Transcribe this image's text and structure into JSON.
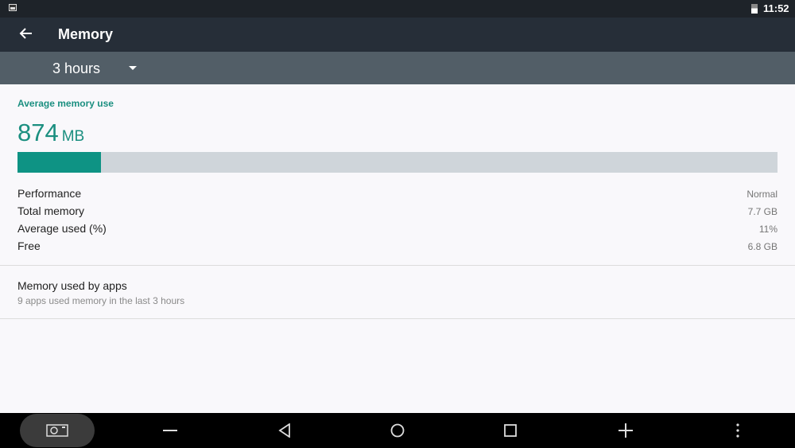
{
  "status_bar": {
    "time": "11:52",
    "icons": [
      "image-notification-icon",
      "battery-icon"
    ]
  },
  "app_bar": {
    "back_icon": "arrow-left-icon",
    "title": "Memory"
  },
  "filter": {
    "selected": "3 hours",
    "icon": "dropdown-caret-icon"
  },
  "summary": {
    "label": "Average memory use",
    "value": "874",
    "unit": "MB",
    "usage_fraction": 0.11,
    "accent_color": "#0e9384",
    "track_color": "#cfd5da"
  },
  "stats": [
    {
      "label": "Performance",
      "value": "Normal"
    },
    {
      "label": "Total memory",
      "value": "7.7 GB"
    },
    {
      "label": "Average used (%)",
      "value": "11%"
    },
    {
      "label": "Free",
      "value": "6.8 GB"
    }
  ],
  "apps": {
    "title": "Memory used by apps",
    "subtitle": "9 apps used memory in the last 3 hours"
  },
  "nav_bar": {
    "buttons": [
      "screenshot-icon",
      "volume-down-icon",
      "back-icon",
      "home-icon",
      "recents-icon",
      "volume-up-icon",
      "more-icon"
    ]
  }
}
